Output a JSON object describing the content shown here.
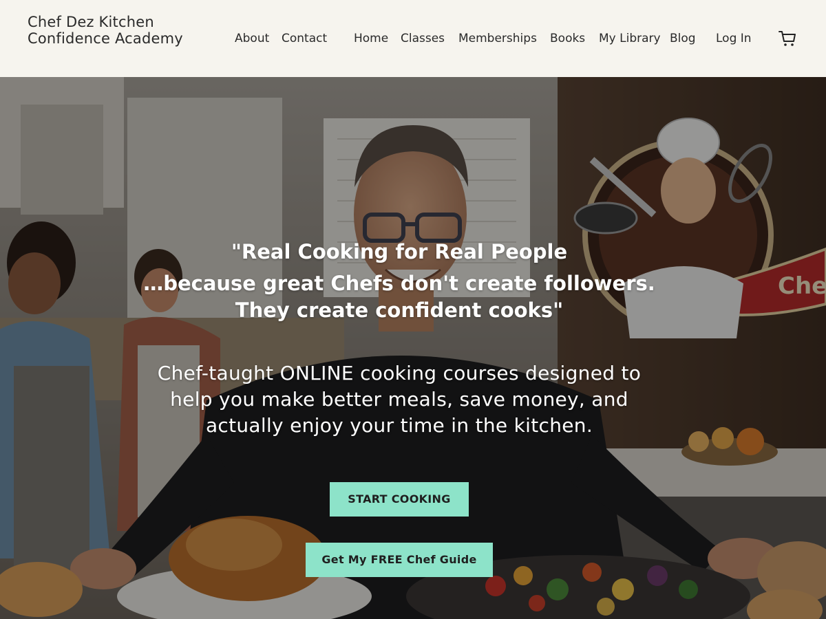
{
  "site": {
    "title": "Chef Dez Kitchen Confidence Academy"
  },
  "nav": {
    "about": "About",
    "contact": "Contact",
    "home": "Home",
    "classes": "Classes",
    "memberships": "Memberships",
    "books": "Books",
    "my_library": "My Library",
    "blog": "Blog",
    "log_in": "Log In",
    "cart_icon": "cart-icon"
  },
  "hero": {
    "headline_line1": "\"Real Cooking for Real People",
    "headline_line2": "…because great Chefs don't create followers. They create confident cooks\"",
    "subheadline": "Chef-taught ONLINE cooking courses designed to help you make better meals, save money, and actually enjoy your time in the kitchen.",
    "primary_cta": "START COOKING",
    "secondary_cta": "Get My FREE Chef Guide",
    "logo_badge_text": "Chef Dez Kitchen"
  },
  "colors": {
    "header_bg": "#f6f4ee",
    "button_bg": "#8de3c9",
    "text_dark": "#2a2a2a",
    "hero_text": "#ffffff"
  }
}
